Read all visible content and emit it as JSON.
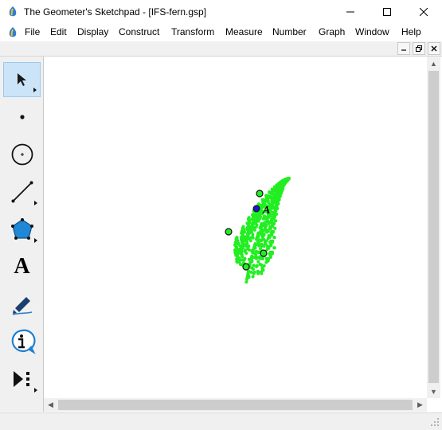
{
  "window": {
    "title": "The Geometer's Sketchpad - [IFS-fern.gsp]",
    "app_icon": "sketchpad-logo-icon",
    "controls": [
      "minimize-icon",
      "maximize-icon",
      "close-icon"
    ]
  },
  "menu": {
    "items": [
      "File",
      "Edit",
      "Display",
      "Construct",
      "Transform",
      "Measure",
      "Number",
      "Graph",
      "Window",
      "Help"
    ]
  },
  "document_controls": [
    "restore-down-icon",
    "restore-icon",
    "close-icon"
  ],
  "toolbox": {
    "tools": [
      {
        "name": "arrow-tool",
        "icon": "arrow-icon",
        "selected": true,
        "has_submenu": true
      },
      {
        "name": "point-tool",
        "icon": "point-icon",
        "selected": false,
        "has_submenu": false
      },
      {
        "name": "compass-tool",
        "icon": "circle-icon",
        "selected": false,
        "has_submenu": false
      },
      {
        "name": "straightedge-tool",
        "icon": "segment-icon",
        "selected": false,
        "has_submenu": true
      },
      {
        "name": "polygon-tool",
        "icon": "pentagon-icon",
        "selected": false,
        "has_submenu": true
      },
      {
        "name": "text-tool",
        "icon": "text-A-icon",
        "selected": false,
        "has_submenu": false
      },
      {
        "name": "marker-tool",
        "icon": "marker-pen-icon",
        "selected": false,
        "has_submenu": false
      },
      {
        "name": "information-tool",
        "icon": "info-icon",
        "selected": false,
        "has_submenu": false
      },
      {
        "name": "custom-tools",
        "icon": "play-menu-icon",
        "selected": false,
        "has_submenu": true
      }
    ],
    "text_tool_glyph": "A"
  },
  "sketch": {
    "point_label": "A",
    "fern_color": "#22ee22",
    "point_color": "#1a1acc",
    "control_point_count": 4
  },
  "colors": {
    "selected_tool_bg": "#cce4f7",
    "chrome": "#f0f0f0"
  }
}
